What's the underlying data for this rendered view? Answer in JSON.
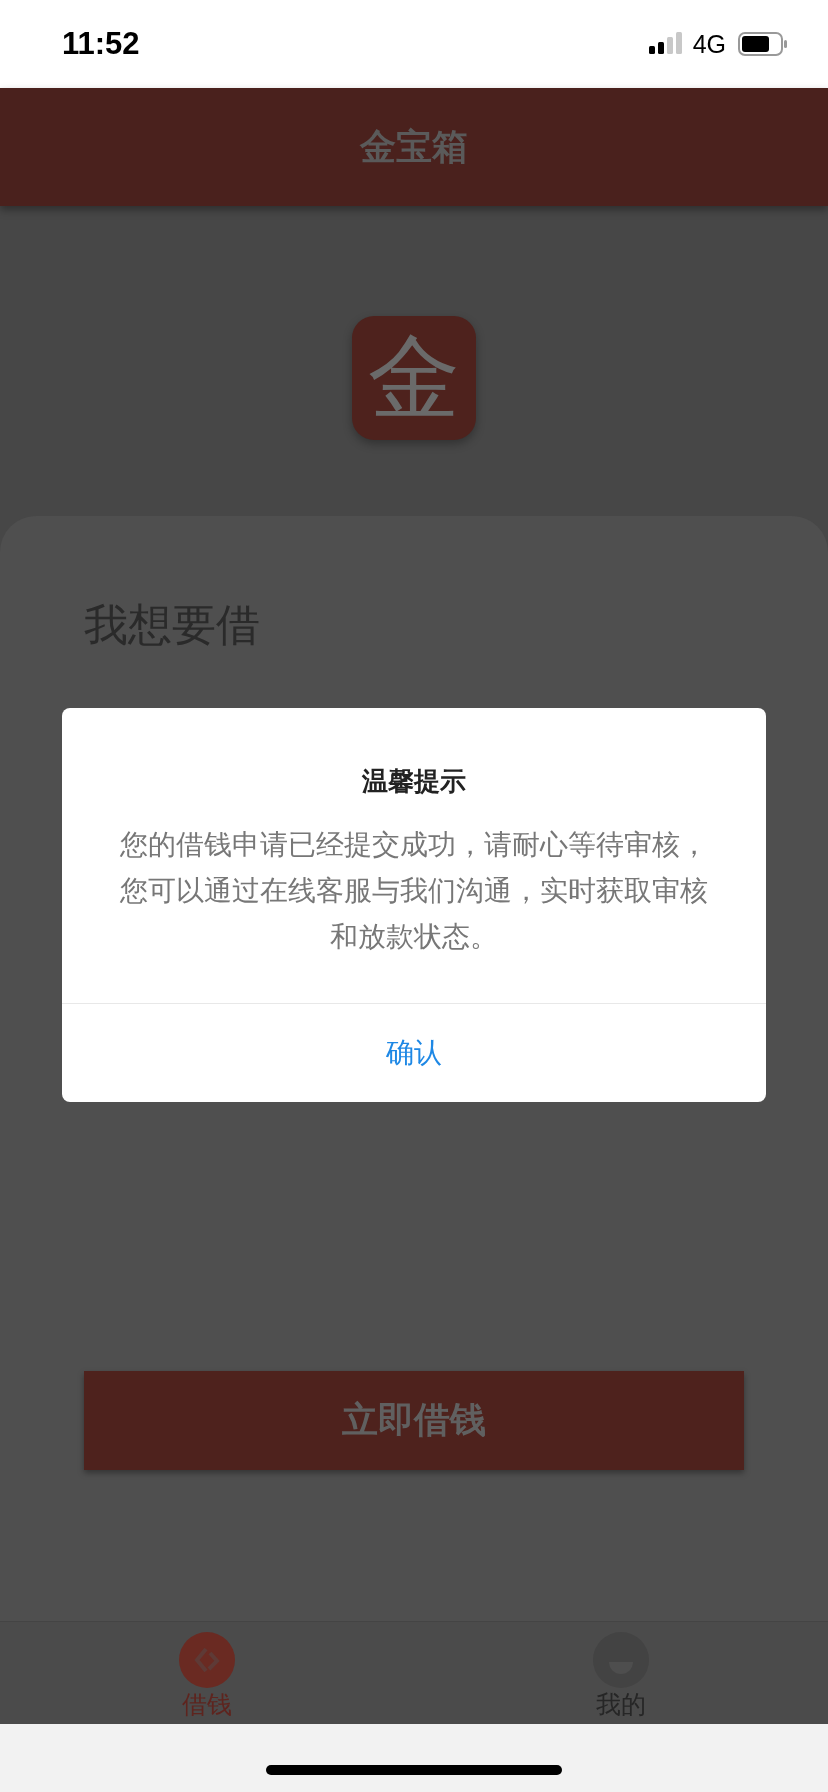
{
  "status_bar": {
    "time": "11:52",
    "network": "4G"
  },
  "header": {
    "title": "金宝箱"
  },
  "logo": {
    "text": "金"
  },
  "loan_card": {
    "heading": "我想要借"
  },
  "primary_button": {
    "label": "立即借钱"
  },
  "dialog": {
    "title": "温馨提示",
    "message": "您的借钱申请已经提交成功，请耐心等待审核，您可以通过在线客服与我们沟通，实时获取审核和放款状态。",
    "confirm": "确认"
  },
  "tabs": [
    {
      "label": "借钱",
      "kind": "loan",
      "selected": true
    },
    {
      "label": "我的",
      "kind": "profile",
      "selected": false
    }
  ]
}
